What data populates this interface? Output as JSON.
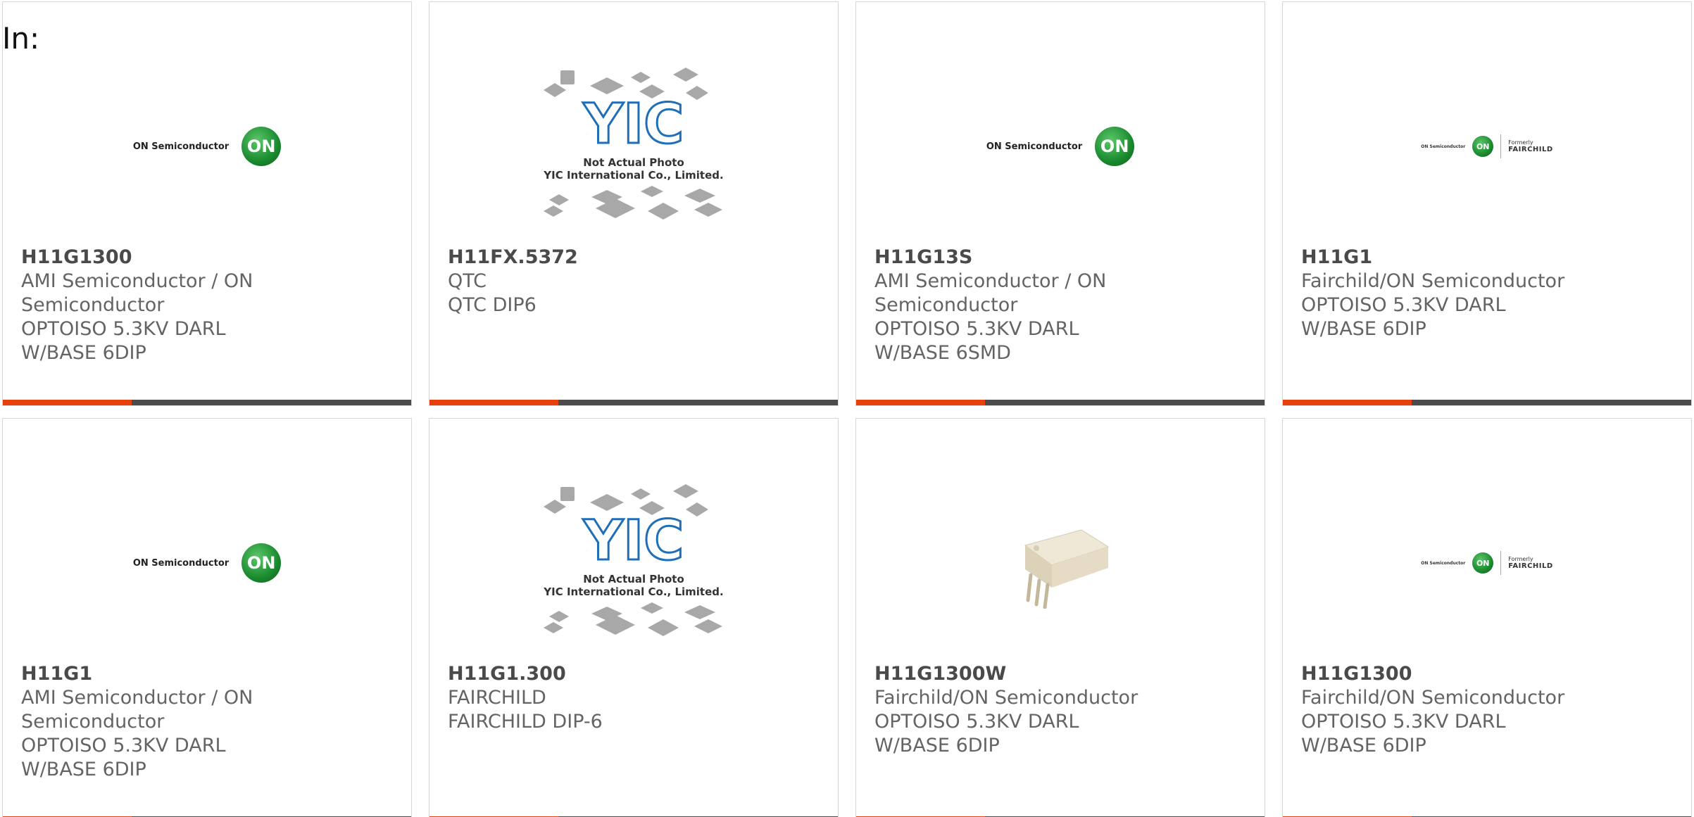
{
  "header": {
    "in_label": "In:"
  },
  "colors": {
    "accent": "#e8400c",
    "bar": "#4b4b4b",
    "on_green": "#1a8a2e"
  },
  "cards": [
    {
      "part": "H11G1300",
      "manufacturer": "AMI Semiconductor / ON Semiconductor",
      "description": "OPTOISO 5.3KV DARL W/BASE 6DIP",
      "image": "on-semiconductor-logo",
      "logo_text": "ON Semiconductor",
      "logo_mark": "ON"
    },
    {
      "part": "H11FX.5372",
      "manufacturer": "QTC",
      "description": "QTC DIP6",
      "image": "yic-not-actual-photo",
      "yic_mark": "YIC",
      "yic_line1": "Not Actual Photo",
      "yic_line2": "YIC International Co., Limited."
    },
    {
      "part": "H11G13S",
      "manufacturer": "AMI Semiconductor / ON Semiconductor",
      "description": "OPTOISO 5.3KV DARL W/BASE 6SMD",
      "image": "on-semiconductor-logo",
      "logo_text": "ON Semiconductor",
      "logo_mark": "ON"
    },
    {
      "part": "H11G1",
      "manufacturer": "Fairchild/ON Semiconductor",
      "description": "OPTOISO 5.3KV DARL W/BASE 6DIP",
      "image": "fairchild-on-logo",
      "logo_text": "ON Semiconductor",
      "logo_mark": "ON",
      "formerly": "Formerly",
      "fairchild": "FAIRCHILD"
    },
    {
      "part": "H11G1",
      "manufacturer": "AMI Semiconductor / ON Semiconductor",
      "description": "OPTOISO 5.3KV DARL W/BASE 6DIP",
      "image": "on-semiconductor-logo",
      "logo_text": "ON Semiconductor",
      "logo_mark": "ON"
    },
    {
      "part": "H11G1.300",
      "manufacturer": "FAIRCHILD",
      "description": "FAIRCHILD DIP-6",
      "image": "yic-not-actual-photo",
      "yic_mark": "YIC",
      "yic_line1": "Not Actual Photo",
      "yic_line2": "YIC International Co., Limited."
    },
    {
      "part": "H11G1300W",
      "manufacturer": "Fairchild/ON Semiconductor",
      "description": "OPTOISO 5.3KV DARL W/BASE 6DIP",
      "image": "dip6-chip-photo"
    },
    {
      "part": "H11G1300",
      "manufacturer": "Fairchild/ON Semiconductor",
      "description": "OPTOISO 5.3KV DARL W/BASE 6DIP",
      "image": "fairchild-on-logo",
      "logo_text": "ON Semiconductor",
      "logo_mark": "ON",
      "formerly": "Formerly",
      "fairchild": "FAIRCHILD"
    }
  ]
}
